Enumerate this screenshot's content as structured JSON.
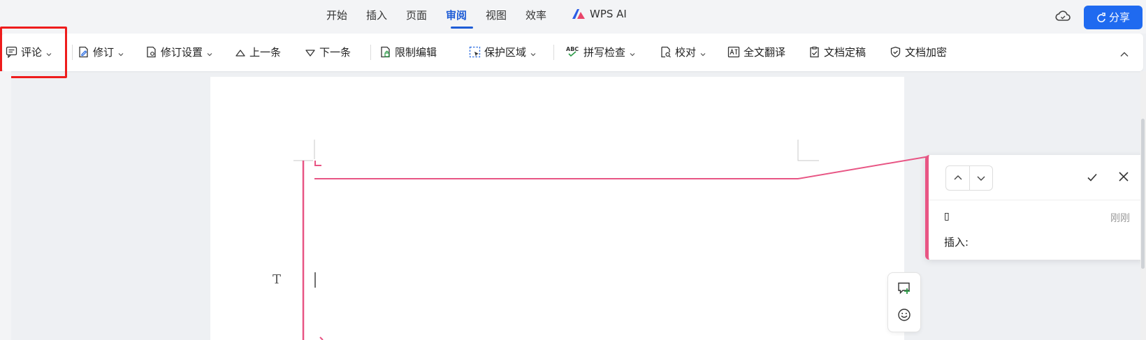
{
  "menu": {
    "tabs": [
      {
        "label": "开始"
      },
      {
        "label": "插入"
      },
      {
        "label": "页面"
      },
      {
        "label": "审阅"
      },
      {
        "label": "视图"
      },
      {
        "label": "效率"
      }
    ],
    "active_tab": "审阅",
    "ai_label": "WPS AI",
    "share_label": "分享"
  },
  "toolbar": {
    "comment": "评论",
    "revise": "修订",
    "revise_settings": "修订设置",
    "prev": "上一条",
    "next": "下一条",
    "restrict_edit": "限制编辑",
    "protect_area": "保护区域",
    "spell_check": "拼写检查",
    "spell_icon_text": "ABC",
    "proofread": "校对",
    "translate": "全文翻译",
    "finalize": "文档定稿",
    "encrypt": "文档加密"
  },
  "comment_panel": {
    "author": "▯",
    "time": "刚刚",
    "body": "插入:"
  },
  "colors": {
    "accent": "#1f5dd6",
    "share_bg": "#1f6af0",
    "revision_pink": "#e85584",
    "highlight_red": "#ee1c1c"
  }
}
